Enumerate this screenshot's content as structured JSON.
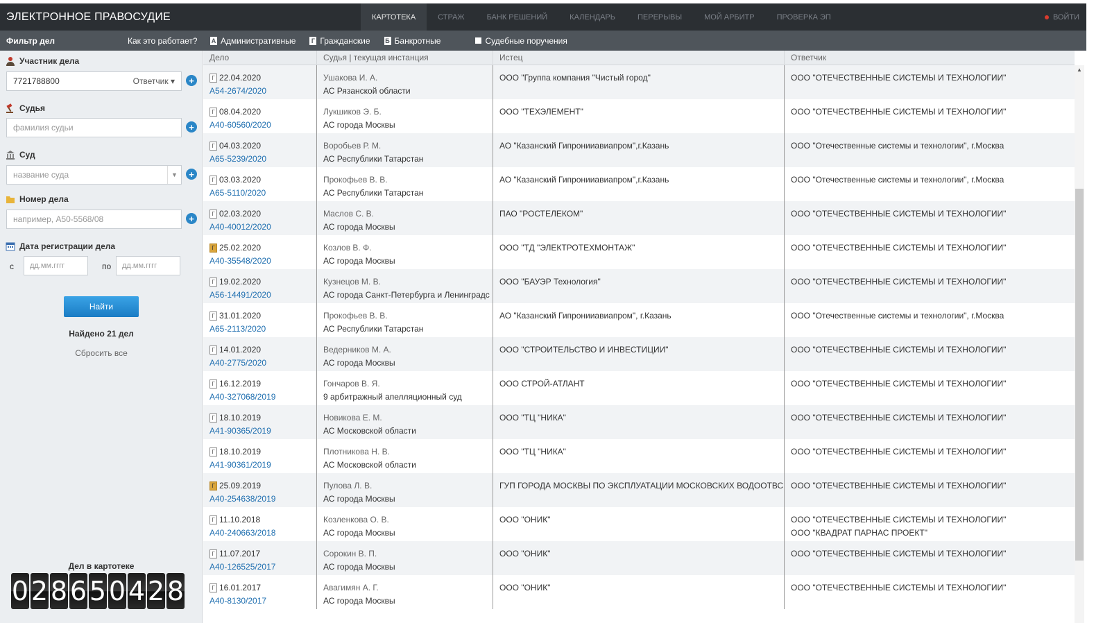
{
  "header": {
    "logo": "ЭЛЕКТРОННОЕ ПРАВОСУДИЕ",
    "nav": [
      "КАРТОТЕКА",
      "СТРАЖ",
      "БАНК РЕШЕНИЙ",
      "КАЛЕНДАРЬ",
      "ПЕРЕРЫВЫ",
      "МОЙ АРБИТР",
      "ПРОВЕРКА ЭП"
    ],
    "login": "ВОЙТИ"
  },
  "filterbar": {
    "title": "Фильтр дел",
    "how": "Как это работает?",
    "types": [
      {
        "icon": "А",
        "label": "Административные"
      },
      {
        "icon": "Г",
        "label": "Гражданские"
      },
      {
        "icon": "Б",
        "label": "Банкротные"
      }
    ],
    "court_orders": "Судебные поручения"
  },
  "sidebar": {
    "participant_label": "Участник дела",
    "participant_value": "7721788800",
    "participant_role": "Ответчик",
    "judge_label": "Судья",
    "judge_placeholder": "фамилия судьи",
    "court_label": "Суд",
    "court_placeholder": "название суда",
    "case_label": "Номер дела",
    "case_placeholder": "например, А50-5568/08",
    "date_label": "Дата регистрации дела",
    "from_label": "с",
    "to_label": "по",
    "date_placeholder": "дд.мм.гггг",
    "find_button": "Найти",
    "found": "Найдено 21 дел",
    "reset": "Сбросить все",
    "counter_title": "Дел в картотеке",
    "counter_digits": [
      "0",
      "2",
      "8",
      "6",
      "5",
      "0",
      "4",
      "2",
      "8"
    ]
  },
  "table": {
    "headers": [
      "Дело",
      "Судья | текущая инстанция",
      "Истец",
      "Ответчик"
    ],
    "rows": [
      {
        "date": "22.04.2020",
        "doc": "Г",
        "gold": false,
        "case": "А54-2674/2020",
        "judge": "Ушакова И. А.",
        "court": "АС Рязанской области",
        "plaintiff": "ООО \"Группа компания \"Чистый город\"",
        "defendant": "ООО \"ОТЕЧЕСТВЕННЫЕ СИСТЕМЫ И ТЕХНОЛОГИИ\"",
        "defendant2": ""
      },
      {
        "date": "08.04.2020",
        "doc": "Г",
        "gold": false,
        "case": "А40-60560/2020",
        "judge": "Лукшиков Э. Б.",
        "court": "АС города Москвы",
        "plaintiff": "ООО \"ТЕХЭЛЕМЕНТ\"",
        "defendant": "ООО \"ОТЕЧЕСТВЕННЫЕ СИСТЕМЫ И ТЕХНОЛОГИИ\"",
        "defendant2": ""
      },
      {
        "date": "04.03.2020",
        "doc": "Г",
        "gold": false,
        "case": "А65-5239/2020",
        "judge": "Воробьев Р. М.",
        "court": "АС Республики Татарстан",
        "plaintiff": "АО \"Казанский Гипронииавиапром\",г.Казань",
        "defendant": "ООО \"Отечественные системы и технологии\", г.Москва",
        "defendant2": ""
      },
      {
        "date": "03.03.2020",
        "doc": "Г",
        "gold": false,
        "case": "А65-5110/2020",
        "judge": "Прокофьев В. В.",
        "court": "АС Республики Татарстан",
        "plaintiff": "АО \"Казанский Гипронииавиапром\",г.Казань",
        "defendant": "ООО \"Отечественные системы и технологии\", г.Москва",
        "defendant2": ""
      },
      {
        "date": "02.03.2020",
        "doc": "Г",
        "gold": false,
        "case": "А40-40012/2020",
        "judge": "Маслов С. В.",
        "court": "АС города Москвы",
        "plaintiff": "ПАО \"РОСТЕЛЕКОМ\"",
        "defendant": "ООО \"ОТЕЧЕСТВЕННЫЕ СИСТЕМЫ И ТЕХНОЛОГИИ\"",
        "defendant2": ""
      },
      {
        "date": "25.02.2020",
        "doc": "Г",
        "gold": true,
        "case": "А40-35548/2020",
        "judge": "Козлов В. Ф.",
        "court": "АС города Москвы",
        "plaintiff": "ООО \"ТД \"ЭЛЕКТРОТЕХМОНТАЖ\"",
        "defendant": "ООО \"ОТЕЧЕСТВЕННЫЕ СИСТЕМЫ И ТЕХНОЛОГИИ\"",
        "defendant2": ""
      },
      {
        "date": "19.02.2020",
        "doc": "Г",
        "gold": false,
        "case": "А56-14491/2020",
        "judge": "Кузнецов М. В.",
        "court": "АС города Санкт-Петербурга и Ленинградс",
        "plaintiff": "ООО \"БАУЭР Технология\"",
        "defendant": "ООО \"ОТЕЧЕСТВЕННЫЕ СИСТЕМЫ И ТЕХНОЛОГИИ\"",
        "defendant2": ""
      },
      {
        "date": "31.01.2020",
        "doc": "Г",
        "gold": false,
        "case": "А65-2113/2020",
        "judge": "Прокофьев В. В.",
        "court": "АС Республики Татарстан",
        "plaintiff": "АО \"Казанский Гипронииавиапром\", г.Казань",
        "defendant": "ООО \"Отечественные системы и технологии\", г.Москва",
        "defendant2": ""
      },
      {
        "date": "14.01.2020",
        "doc": "Г",
        "gold": false,
        "case": "А40-2775/2020",
        "judge": "Ведерников М. А.",
        "court": "АС города Москвы",
        "plaintiff": "ООО \"СТРОИТЕЛЬСТВО И ИНВЕСТИЦИИ\"",
        "defendant": "ООО \"ОТЕЧЕСТВЕННЫЕ СИСТЕМЫ И ТЕХНОЛОГИИ\"",
        "defendant2": ""
      },
      {
        "date": "16.12.2019",
        "doc": "Г",
        "gold": false,
        "case": "А40-327068/2019",
        "judge": "Гончаров В. Я.",
        "court": "9 арбитражный апелляционный суд",
        "plaintiff": "ООО СТРОЙ-АТЛАНТ",
        "defendant": "ООО \"ОТЕЧЕСТВЕННЫЕ СИСТЕМЫ И ТЕХНОЛОГИИ\"",
        "defendant2": ""
      },
      {
        "date": "18.10.2019",
        "doc": "Г",
        "gold": false,
        "case": "А41-90365/2019",
        "judge": "Новикова Е. М.",
        "court": "АС Московской области",
        "plaintiff": "ООО \"ТЦ \"НИКА\"",
        "defendant": "ООО \"ОТЕЧЕСТВЕННЫЕ СИСТЕМЫ И ТЕХНОЛОГИИ\"",
        "defendant2": ""
      },
      {
        "date": "18.10.2019",
        "doc": "Г",
        "gold": false,
        "case": "А41-90361/2019",
        "judge": "Плотникова Н. В.",
        "court": "АС Московской области",
        "plaintiff": "ООО \"ТЦ \"НИКА\"",
        "defendant": "ООО \"ОТЕЧЕСТВЕННЫЕ СИСТЕМЫ И ТЕХНОЛОГИИ\"",
        "defendant2": ""
      },
      {
        "date": "25.09.2019",
        "doc": "Г",
        "gold": true,
        "case": "А40-254638/2019",
        "judge": "Пулова Л. В.",
        "court": "АС города Москвы",
        "plaintiff": "ГУП ГОРОДА МОСКВЫ ПО ЭКСПЛУАТАЦИИ МОСКОВСКИХ ВОДООТВС",
        "defendant": "ООО \"ОТЕЧЕСТВЕННЫЕ СИСТЕМЫ И ТЕХНОЛОГИИ\"",
        "defendant2": ""
      },
      {
        "date": "11.10.2018",
        "doc": "Г",
        "gold": false,
        "case": "А40-240663/2018",
        "judge": "Козленкова О. В.",
        "court": "АС города Москвы",
        "plaintiff": "ООО \"ОНИК\"",
        "defendant": "ООО \"ОТЕЧЕСТВЕННЫЕ СИСТЕМЫ И ТЕХНОЛОГИИ\"",
        "defendant2": "ООО \"КВАДРАТ ПАРНАС ПРОЕКТ\""
      },
      {
        "date": "11.07.2017",
        "doc": "Г",
        "gold": false,
        "case": "А40-126525/2017",
        "judge": "Сорокин В. П.",
        "court": "АС города Москвы",
        "plaintiff": "ООО \"ОНИК\"",
        "defendant": "ООО \"ОТЕЧЕСТВЕННЫЕ СИСТЕМЫ И ТЕХНОЛОГИИ\"",
        "defendant2": ""
      },
      {
        "date": "16.01.2017",
        "doc": "Г",
        "gold": false,
        "case": "А40-8130/2017",
        "judge": "Авагимян А. Г.",
        "court": "АС города Москвы",
        "plaintiff": "ООО \"ОНИК\"",
        "defendant": "ООО \"ОТЕЧЕСТВЕННЫЕ СИСТЕМЫ И ТЕХНОЛОГИИ\"",
        "defendant2": ""
      }
    ]
  }
}
